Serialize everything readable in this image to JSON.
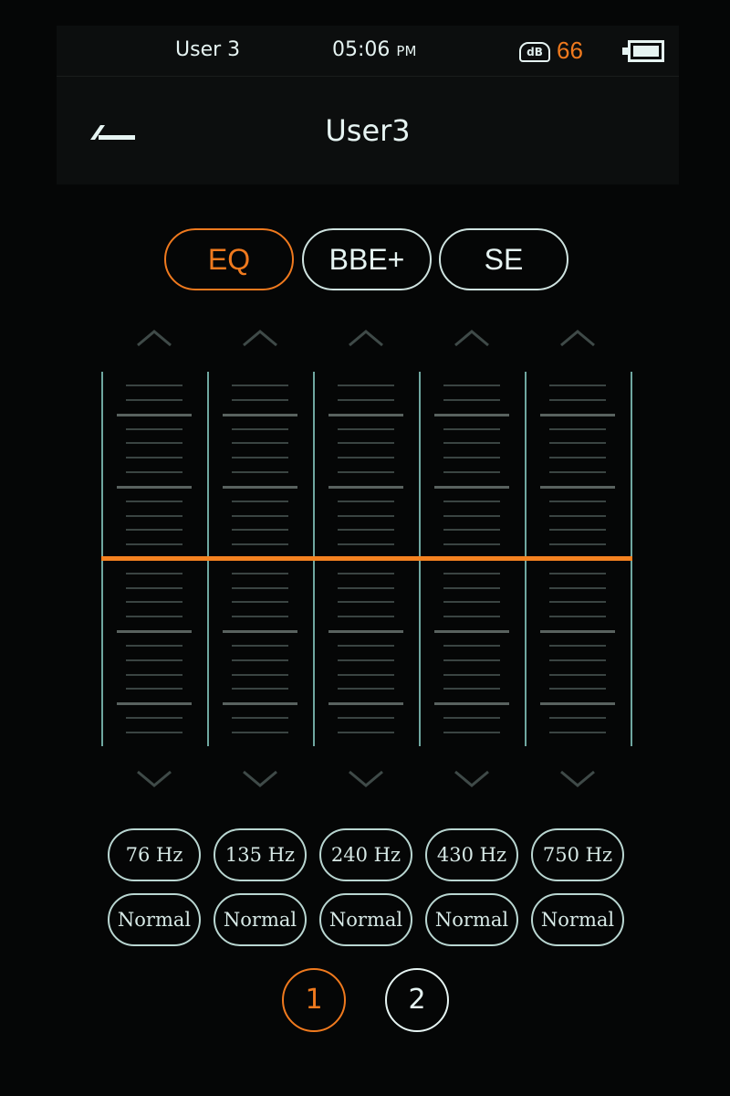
{
  "status": {
    "profile": "User 3",
    "time": "05:06",
    "ampm": "PM",
    "volume_icon_label": "dB",
    "volume": "66",
    "battery_level": 1.0
  },
  "header": {
    "title": "User3",
    "back_icon": "back-arrow-icon"
  },
  "tabs": [
    {
      "label": "EQ",
      "active": true
    },
    {
      "label": "BBE+",
      "active": false
    },
    {
      "label": "SE",
      "active": false
    }
  ],
  "bands": [
    {
      "freq": "76 Hz",
      "q": "Normal",
      "gain": 0
    },
    {
      "freq": "135 Hz",
      "q": "Normal",
      "gain": 0
    },
    {
      "freq": "240 Hz",
      "q": "Normal",
      "gain": 0
    },
    {
      "freq": "430 Hz",
      "q": "Normal",
      "gain": 0
    },
    {
      "freq": "750 Hz",
      "q": "Normal",
      "gain": 0
    }
  ],
  "pages": [
    {
      "label": "1",
      "active": true
    },
    {
      "label": "2",
      "active": false
    }
  ],
  "colors": {
    "accent": "#f58220",
    "text": "#e6f4f2",
    "bar": "#6fa7a0"
  }
}
